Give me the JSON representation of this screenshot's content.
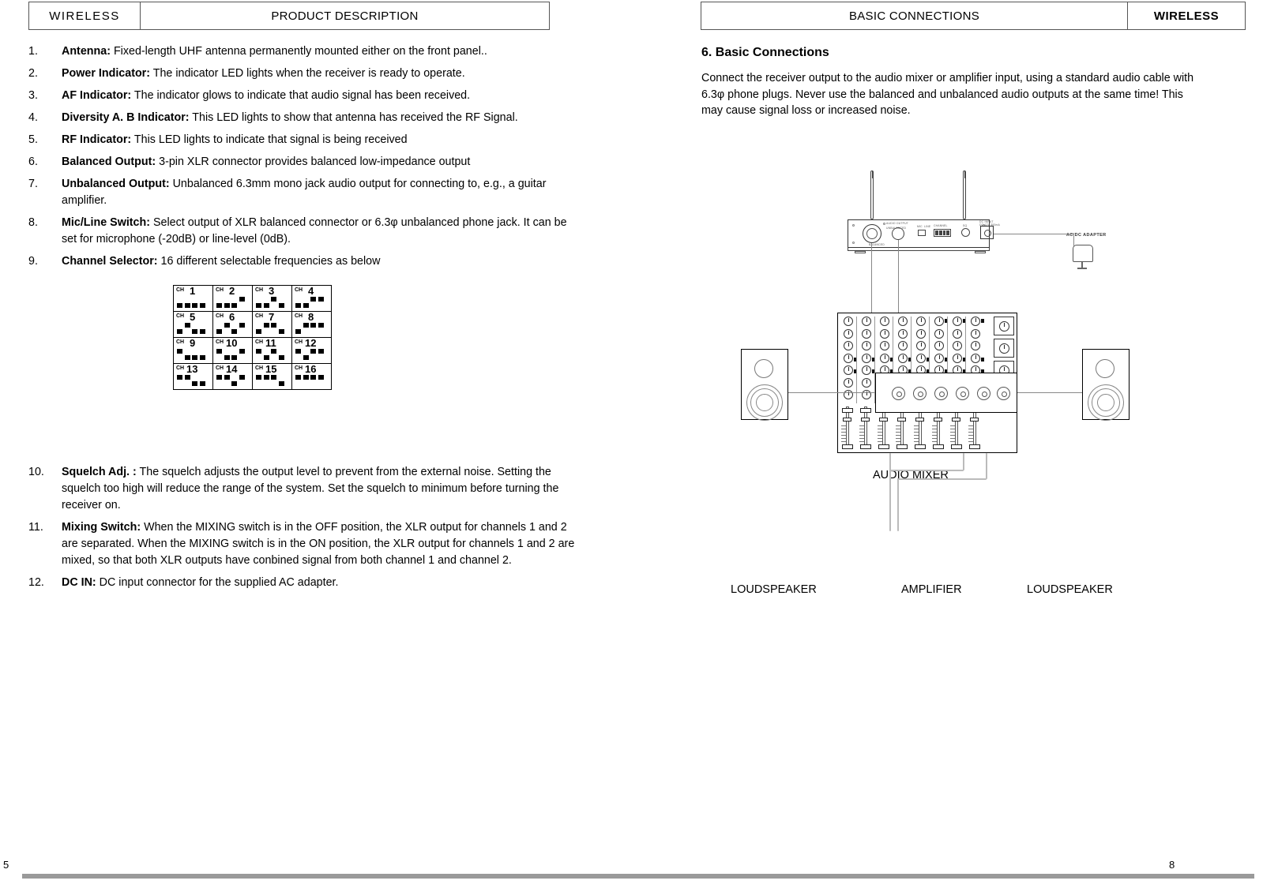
{
  "left_page": {
    "header": {
      "brand": "WIRELESS",
      "section": "PRODUCT DESCRIPTION"
    },
    "page_number": "5",
    "items": [
      {
        "num": "1.",
        "term": "Antenna:",
        "desc": "Fixed-length UHF antenna permanently mounted either on the front panel.."
      },
      {
        "num": "2.",
        "term": "Power Indicator:",
        "desc": "The indicator LED lights when the receiver is ready to operate."
      },
      {
        "num": "3.",
        "term": "AF Indicator:",
        "desc": "The indicator glows to indicate that audio signal has been received."
      },
      {
        "num": "4.",
        "term": "Diversity A. B Indicator:",
        "desc": "This LED lights to show that antenna has received the RF Signal."
      },
      {
        "num": "5.",
        "term": "RF Indicator:",
        "desc": "This LED lights to indicate that signal is being received"
      },
      {
        "num": "6.",
        "term": "Balanced Output:",
        "desc": "3-pin XLR connector provides balanced low-impedance output"
      },
      {
        "num": "7.",
        "term": "Unbalanced Output:",
        "desc": "Unbalanced 6.3mm mono jack audio output for connecting to, e.g., a guitar amplifier."
      },
      {
        "num": "8.",
        "term": "Mic/Line Switch:",
        "desc": "Select output of XLR balanced connector or 6.3φ unbalanced phone jack.    It can be set for microphone (-20dB) or line-level (0dB)."
      },
      {
        "num": "9.",
        "term": "Channel Selector:",
        "desc": "16 different selectable frequencies as below"
      }
    ],
    "items2": [
      {
        "num": "10.",
        "term": "Squelch Adj. :",
        "desc": "The squelch adjusts the output level to prevent from the external noise. Setting the squelch too high will reduce the range of the system.    Set the squelch to minimum before turning the receiver on."
      },
      {
        "num": "11.",
        "term": "Mixing Switch:",
        "desc": "When the MIXING switch is in the OFF position, the XLR output for channels 1 and 2 are separated.    When the MIXING switch is in the ON position, the XLR output for channels 1 and 2 are mixed, so that both XLR outputs have conbined signal from both channel 1 and channel 2."
      },
      {
        "num": "12.",
        "term": "DC IN:",
        "desc": "DC input connector for the supplied AC adapter."
      }
    ],
    "channel_table": {
      "ch_prefix": "CH",
      "cells": [
        {
          "ch": "1",
          "dip": [
            0,
            0,
            0,
            0
          ]
        },
        {
          "ch": "2",
          "dip": [
            0,
            0,
            0,
            1
          ]
        },
        {
          "ch": "3",
          "dip": [
            0,
            0,
            1,
            0
          ]
        },
        {
          "ch": "4",
          "dip": [
            0,
            0,
            1,
            1
          ]
        },
        {
          "ch": "5",
          "dip": [
            0,
            1,
            0,
            0
          ]
        },
        {
          "ch": "6",
          "dip": [
            0,
            1,
            0,
            1
          ]
        },
        {
          "ch": "7",
          "dip": [
            0,
            1,
            1,
            0
          ]
        },
        {
          "ch": "8",
          "dip": [
            0,
            1,
            1,
            1
          ]
        },
        {
          "ch": "9",
          "dip": [
            1,
            0,
            0,
            0
          ]
        },
        {
          "ch": "10",
          "dip": [
            1,
            0,
            0,
            1
          ]
        },
        {
          "ch": "11",
          "dip": [
            1,
            0,
            1,
            0
          ]
        },
        {
          "ch": "12",
          "dip": [
            1,
            0,
            1,
            1
          ]
        },
        {
          "ch": "13",
          "dip": [
            1,
            1,
            0,
            0
          ]
        },
        {
          "ch": "14",
          "dip": [
            1,
            1,
            0,
            1
          ]
        },
        {
          "ch": "15",
          "dip": [
            1,
            1,
            1,
            0
          ]
        },
        {
          "ch": "16",
          "dip": [
            1,
            1,
            1,
            1
          ]
        }
      ]
    }
  },
  "right_page": {
    "header": {
      "section": "BASIC CONNECTIONS",
      "brand": "WIRELESS"
    },
    "page_number": "8",
    "title": "6. Basic Connections",
    "paragraph": "Connect the receiver output to the audio mixer or amplifier input, using a standard audio cable with 6.3φ phone plugs. Never use the balanced and unbalanced audio outputs at the same time!    This may cause signal loss or increased noise.",
    "diagram": {
      "labels": {
        "audio_mixer": "AUDIO MIXER",
        "amplifier": "AMPLIFIER",
        "loudspeaker_left": "LOUDSPEAKER",
        "loudspeaker_right": "LOUDSPEAKER",
        "ac_dc_adapter": "AC/DC ADAPTER"
      },
      "receiver_panel_text": {
        "audio_output": "AUDIO OUTPUT",
        "unbalanced": "UNBALANCED",
        "balanced": "BALANCED",
        "mic": "MIC",
        "line": "LINE",
        "channel": "CHANNEL",
        "sq": "SQ",
        "dc_input": "DC INPUT",
        "dc_12v": "DC 12V 300mA"
      }
    }
  },
  "colors": {
    "ink": "#000000",
    "rule": "#555555",
    "footer_bar": "#9a9a9a",
    "wire": "#888888"
  }
}
